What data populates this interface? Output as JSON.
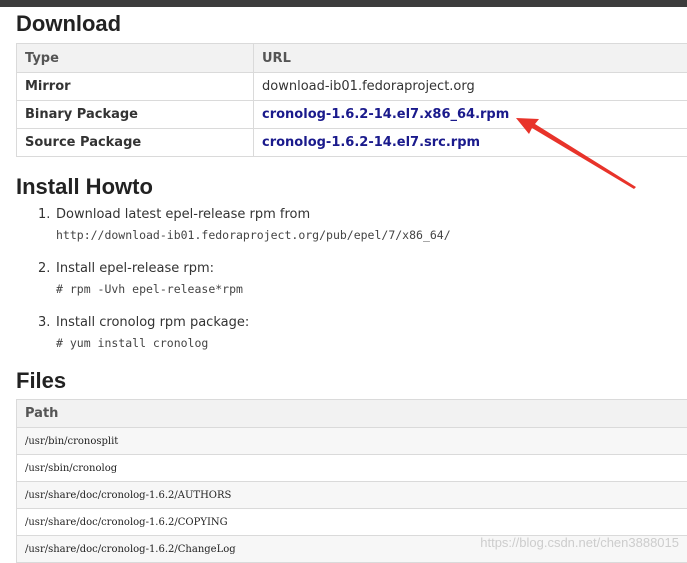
{
  "download": {
    "heading": "Download",
    "col_type": "Type",
    "col_url": "URL",
    "rows": [
      {
        "type": "Mirror",
        "url": "download-ib01.fedoraproject.org"
      },
      {
        "type": "Binary Package",
        "url": "cronolog-1.6.2-14.el7.x86_64.rpm"
      },
      {
        "type": "Source Package",
        "url": "cronolog-1.6.2-14.el7.src.rpm"
      }
    ]
  },
  "howto": {
    "heading": "Install Howto",
    "steps": [
      {
        "num": "1.",
        "text": "Download latest epel-release rpm from",
        "code": "http://download-ib01.fedoraproject.org/pub/epel/7/x86_64/"
      },
      {
        "num": "2.",
        "text": "Install epel-release rpm:",
        "code": "# rpm -Uvh epel-release*rpm"
      },
      {
        "num": "3.",
        "text": "Install cronolog rpm package:",
        "code": "# yum install cronolog"
      }
    ]
  },
  "files": {
    "heading": "Files",
    "col_path": "Path",
    "rows": [
      "/usr/bin/cronosplit",
      "/usr/sbin/cronolog",
      "/usr/share/doc/cronolog-1.6.2/AUTHORS",
      "/usr/share/doc/cronolog-1.6.2/COPYING",
      "/usr/share/doc/cronolog-1.6.2/ChangeLog"
    ]
  },
  "watermark": "https://blog.csdn.net/chen3888015",
  "annotation": {
    "arrow_color": "#e8332a"
  }
}
